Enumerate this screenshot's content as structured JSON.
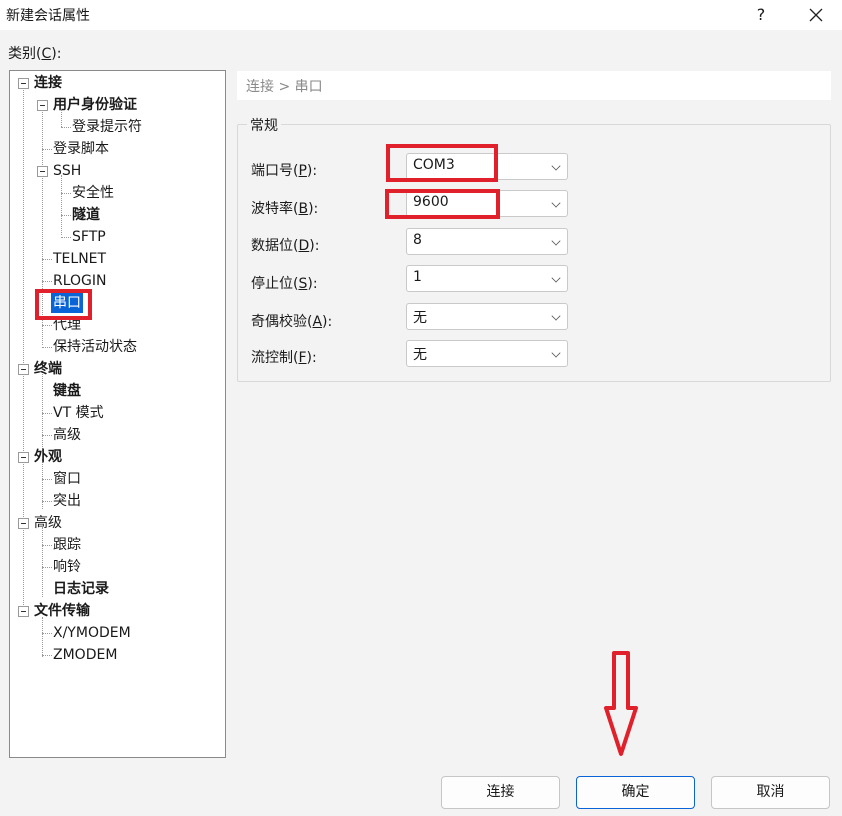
{
  "window": {
    "title": "新建会话属性",
    "help": "?",
    "close": "✕"
  },
  "category": {
    "label_prefix": "类别(",
    "accel": "C",
    "label_suffix": "):"
  },
  "tree": [
    {
      "label": "连接",
      "bold": true
    },
    {
      "label": "用户身份验证",
      "bold": true
    },
    {
      "label": "登录提示符",
      "bold": false
    },
    {
      "label": "登录脚本",
      "bold": false
    },
    {
      "label": "SSH",
      "bold": false
    },
    {
      "label": "安全性",
      "bold": false
    },
    {
      "label": "隧道",
      "bold": true
    },
    {
      "label": "SFTP",
      "bold": false
    },
    {
      "label": "TELNET",
      "bold": false
    },
    {
      "label": "RLOGIN",
      "bold": false
    },
    {
      "label": "串口",
      "bold": false,
      "selected": true
    },
    {
      "label": "代理",
      "bold": false
    },
    {
      "label": "保持活动状态",
      "bold": false
    },
    {
      "label": "终端",
      "bold": true
    },
    {
      "label": "键盘",
      "bold": true
    },
    {
      "label": "VT 模式",
      "bold": false
    },
    {
      "label": "高级",
      "bold": false
    },
    {
      "label": "外观",
      "bold": true
    },
    {
      "label": "窗口",
      "bold": false
    },
    {
      "label": "突出",
      "bold": false
    },
    {
      "label": "高级",
      "bold": false
    },
    {
      "label": "跟踪",
      "bold": false
    },
    {
      "label": "响铃",
      "bold": false
    },
    {
      "label": "日志记录",
      "bold": true
    },
    {
      "label": "文件传输",
      "bold": true
    },
    {
      "label": "X/YMODEM",
      "bold": false
    },
    {
      "label": "ZMODEM",
      "bold": false
    }
  ],
  "breadcrumb": "连接 > 串口",
  "group_title": "常规",
  "fields": [
    {
      "label": "端口号(",
      "accel": "P",
      "suffix": "):",
      "value": "COM3"
    },
    {
      "label": "波特率(",
      "accel": "B",
      "suffix": "):",
      "value": "9600"
    },
    {
      "label": "数据位(",
      "accel": "D",
      "suffix": "):",
      "value": "8"
    },
    {
      "label": "停止位(",
      "accel": "S",
      "suffix": "):",
      "value": "1"
    },
    {
      "label": "奇偶校验(",
      "accel": "A",
      "suffix": "):",
      "value": "无"
    },
    {
      "label": "流控制(",
      "accel": "F",
      "suffix": "):",
      "value": "无"
    }
  ],
  "buttons": {
    "connect": "连接",
    "ok": "确定",
    "cancel": "取消"
  },
  "colors": {
    "annotation_red": "#e0202a",
    "selection_blue": "#0a64d6"
  }
}
